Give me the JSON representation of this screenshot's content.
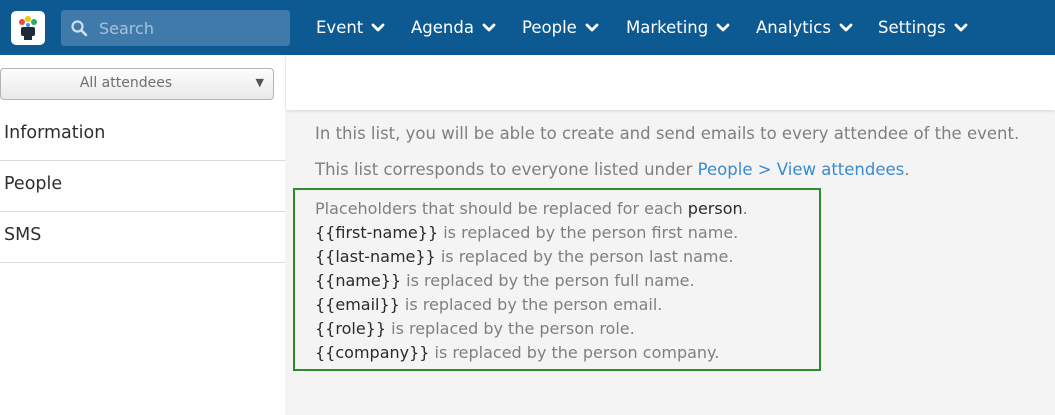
{
  "search": {
    "placeholder": "Search"
  },
  "nav": [
    {
      "label": "Event"
    },
    {
      "label": "Agenda"
    },
    {
      "label": "People"
    },
    {
      "label": "Marketing"
    },
    {
      "label": "Analytics"
    },
    {
      "label": "Settings"
    }
  ],
  "sidebar": {
    "filter": {
      "selected": "All attendees"
    },
    "items": [
      {
        "label": "Information"
      },
      {
        "label": "People"
      },
      {
        "label": "SMS"
      }
    ]
  },
  "main": {
    "intro": "In this list, you will be able to create and send emails to every attendee of the event.",
    "list_desc": {
      "prefix": "This list corresponds to everyone listed under ",
      "link": "People > View attendees",
      "suffix": "."
    },
    "placeholders": {
      "header_prefix": "Placeholders that should be replaced for each ",
      "header_emph": "person",
      "header_suffix": ".",
      "rows": [
        {
          "token": "{{first-name}}",
          "text": " is replaced by the person first name."
        },
        {
          "token": "{{last-name}}",
          "text": " is replaced by the person last name."
        },
        {
          "token": "{{name}}",
          "text": " is replaced by the person full name."
        },
        {
          "token": "{{email}}",
          "text": " is replaced by the person email."
        },
        {
          "token": "{{role}}",
          "text": " is replaced by the person role."
        },
        {
          "token": "{{company}}",
          "text": " is replaced by the person company."
        }
      ]
    }
  },
  "colors": {
    "nav_bg": "#0d5a93",
    "link": "#3a8ad0",
    "highlight_border": "#2e8b2e"
  }
}
